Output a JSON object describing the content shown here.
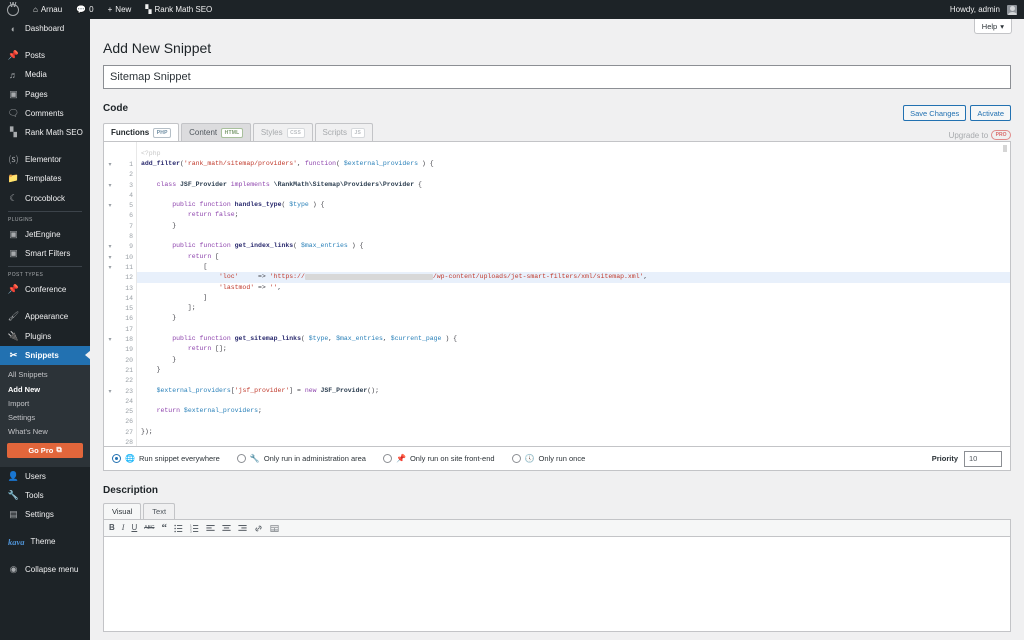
{
  "adminbar": {
    "logo": "wordpress-logo",
    "site_name": "Arnau",
    "comments_count": "0",
    "new_label": "New",
    "plugin_label": "Rank Math SEO",
    "howdy": "Howdy, admin"
  },
  "help_tab": {
    "label": "Help",
    "caret": "▾"
  },
  "sidebar": {
    "items": [
      {
        "label": "Dashboard",
        "icon": "dashboard-icon",
        "glyph": "⌂"
      },
      {
        "label": "Posts",
        "icon": "pin-icon",
        "glyph": "✎"
      },
      {
        "label": "Media",
        "icon": "media-icon",
        "glyph": "♪"
      },
      {
        "label": "Pages",
        "icon": "pages-icon",
        "glyph": "❐"
      },
      {
        "label": "Comments",
        "icon": "comments-icon",
        "glyph": "▬"
      },
      {
        "label": "Rank Math SEO",
        "icon": "chart-icon",
        "glyph": "▐"
      }
    ],
    "group2": [
      {
        "label": "Elementor",
        "icon": "elementor-icon",
        "glyph": "ⓔ"
      },
      {
        "label": "Templates",
        "icon": "folder-icon",
        "glyph": "▰"
      },
      {
        "label": "Crocoblock",
        "icon": "moon-icon",
        "glyph": "☾"
      }
    ],
    "plugins_label": "PLUGINS",
    "plugins": [
      {
        "label": "JetEngine",
        "icon": "jetengine-icon",
        "glyph": "▣"
      },
      {
        "label": "Smart Filters",
        "icon": "smartfilters-icon",
        "glyph": "▣"
      }
    ],
    "posttypes_label": "POST TYPES",
    "posttypes": [
      {
        "label": "Conference",
        "icon": "pin-icon",
        "glyph": "✎"
      }
    ],
    "group3": [
      {
        "label": "Appearance",
        "icon": "brush-icon",
        "glyph": "✎"
      },
      {
        "label": "Plugins",
        "icon": "plug-icon",
        "glyph": "⚡"
      }
    ],
    "snippets": {
      "label": "Snippets",
      "icon": "scissors-icon",
      "glyph": "✂"
    },
    "snippets_submenu": [
      {
        "label": "All Snippets",
        "current": false
      },
      {
        "label": "Add New",
        "current": true
      },
      {
        "label": "Import",
        "current": false
      },
      {
        "label": "Settings",
        "current": false
      },
      {
        "label": "What's New",
        "current": false
      }
    ],
    "go_pro": {
      "label": "Go Pro",
      "icon": "external-link-icon",
      "glyph": "⧉"
    },
    "group4": [
      {
        "label": "Users",
        "icon": "users-icon",
        "glyph": "⚹"
      },
      {
        "label": "Tools",
        "icon": "wrench-icon",
        "glyph": "⚒"
      },
      {
        "label": "Settings",
        "icon": "sliders-icon",
        "glyph": "⚙"
      }
    ],
    "theme": {
      "logo": "kava",
      "label": "Theme"
    },
    "collapse": {
      "label": "Collapse menu",
      "icon": "collapse-icon",
      "glyph": "◀"
    },
    "accent_color": "#2271b1",
    "gopro_color": "#e2663b"
  },
  "page": {
    "title": "Add New Snippet",
    "snippet_title_value": "Sitemap Snippet",
    "code_heading": "Code",
    "description_heading": "Description"
  },
  "code_tabs": [
    {
      "label": "Functions",
      "badge": "PHP",
      "state": "active"
    },
    {
      "label": "Content",
      "badge": "HTML",
      "state": "inactive"
    },
    {
      "label": "Styles",
      "badge": "CSS",
      "state": "muted"
    },
    {
      "label": "Scripts",
      "badge": "JS",
      "state": "muted"
    }
  ],
  "actions": {
    "save_label": "Save Changes",
    "activate_label": "Activate",
    "upgrade_label": "Upgrade to",
    "upgrade_badge": "PRO"
  },
  "editor": {
    "php_hint": "<?php",
    "total_lines": 28,
    "highlight_line": 12,
    "fold_lines": [
      1,
      3,
      5,
      9,
      10,
      11,
      18,
      23
    ],
    "lines": [
      "add_filter('rank_math/sitemap/providers', function( $external_providers ) {",
      "",
      "    class JSF_Provider implements \\RankMath\\Sitemap\\Providers\\Provider {",
      "",
      "        public function handles_type( $type ) {",
      "            return false;",
      "        }",
      "",
      "        public function get_index_links( $max_entries ) {",
      "            return [",
      "                [",
      "                    'loc'     => 'https://[REDACTED]/wp-content/uploads/jet-smart-filters/xml/sitemap.xml',",
      "                    'lastmod' => '',",
      "                ]",
      "            ];",
      "        }",
      "",
      "        public function get_sitemap_links( $type, $max_entries, $current_page ) {",
      "            return [];",
      "        }",
      "    }",
      "",
      "    $external_providers['jsf_provider'] = new JSF_Provider();",
      "",
      "    return $external_providers;",
      "",
      "});",
      ""
    ]
  },
  "scope": {
    "options": [
      {
        "label": "Run snippet everywhere",
        "icon": "globe-icon",
        "glyph": "⊕",
        "selected": true
      },
      {
        "label": "Only run in administration area",
        "icon": "wrench-icon",
        "glyph": "⚒",
        "selected": false
      },
      {
        "label": "Only run on site front-end",
        "icon": "pin-icon",
        "glyph": "✒",
        "selected": false
      },
      {
        "label": "Only run once",
        "icon": "clock-icon",
        "glyph": "◴",
        "selected": false
      }
    ],
    "priority_label": "Priority",
    "priority_value": "10"
  },
  "description_editor": {
    "tabs": [
      {
        "label": "Visual",
        "active": true
      },
      {
        "label": "Text",
        "active": false
      }
    ],
    "toolbar": [
      {
        "name": "bold-icon",
        "glyph": "B"
      },
      {
        "name": "italic-icon",
        "glyph": "I"
      },
      {
        "name": "underline-icon",
        "glyph": "U"
      },
      {
        "name": "strikethrough-icon",
        "glyph": "ABC"
      },
      {
        "name": "blockquote-icon",
        "glyph": "“"
      },
      {
        "name": "bulleted-list-icon",
        "glyph": "☰"
      },
      {
        "name": "numbered-list-icon",
        "glyph": "☰"
      },
      {
        "name": "align-left-icon",
        "glyph": "☰"
      },
      {
        "name": "align-center-icon",
        "glyph": "☰"
      },
      {
        "name": "align-right-icon",
        "glyph": "☰"
      },
      {
        "name": "link-icon",
        "glyph": "ὑ7"
      },
      {
        "name": "more-toolbar-icon",
        "glyph": "▦"
      }
    ],
    "body_value": ""
  }
}
